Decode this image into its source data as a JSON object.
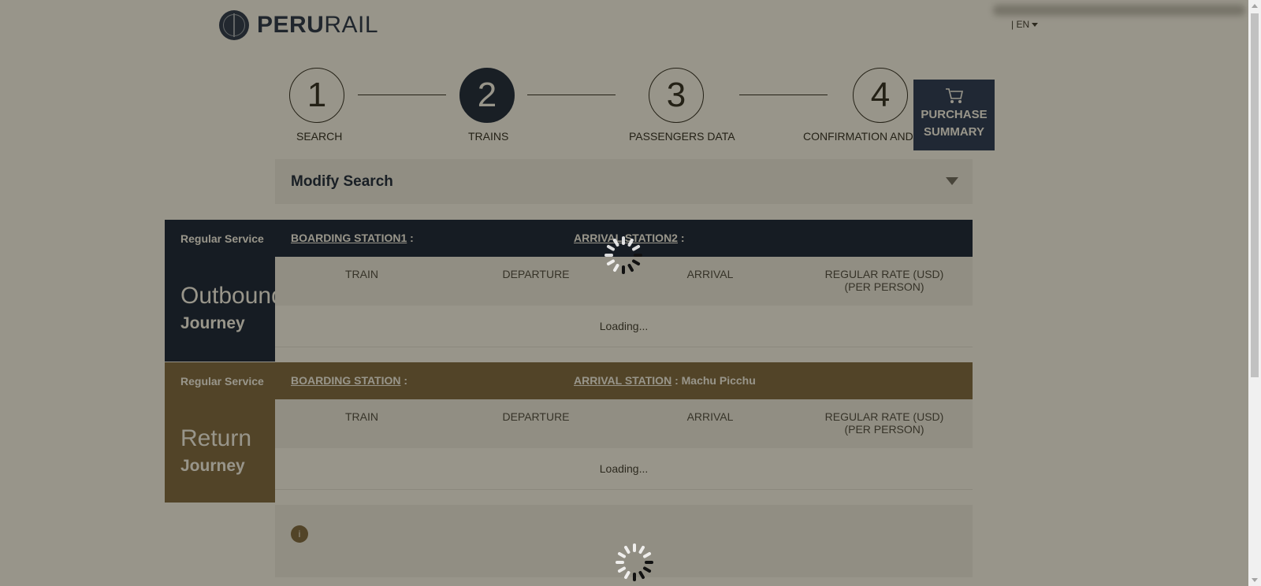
{
  "header": {
    "logo_bold": "PERU",
    "logo_light": "RAIL",
    "language": "| EN"
  },
  "stepper": {
    "steps": [
      {
        "number": "1",
        "label": "SEARCH",
        "active": false
      },
      {
        "number": "2",
        "label": "TRAINS",
        "active": true
      },
      {
        "number": "3",
        "label": "PASSENGERS DATA",
        "active": false
      },
      {
        "number": "4",
        "label": "CONFIRMATION AND P",
        "active": false
      }
    ]
  },
  "purchase_summary": {
    "line1": "PURCHASE",
    "line2": "SUMMARY"
  },
  "modify_search": {
    "title": "Modify Search"
  },
  "outbound": {
    "service": "Regular Service",
    "title": "Outbound",
    "subtitle": "Journey",
    "boarding_label": "BOARDING STATION1",
    "boarding_value": ":",
    "arrival_label": "ARRIVAL STATION2",
    "arrival_value": ":",
    "columns": [
      "TRAIN",
      "DEPARTURE",
      "ARRIVAL",
      "REGULAR RATE (USD)",
      "(PER PERSON)"
    ],
    "loading": "Loading..."
  },
  "return": {
    "service": "Regular Service",
    "title": "Return",
    "subtitle": "Journey",
    "boarding_label": "BOARDING STATION",
    "boarding_value": ":",
    "arrival_label": "ARRIVAL STATION",
    "arrival_value": ": Machu Picchu",
    "columns": [
      "TRAIN",
      "DEPARTURE",
      "ARRIVAL",
      "REGULAR RATE (USD)",
      "(PER PERSON)"
    ],
    "loading": "Loading..."
  },
  "info": {
    "icon_text": "i"
  },
  "colors": {
    "navy": "#06183a",
    "brown": "#7a6544",
    "purchase": "#1a2f5a"
  }
}
